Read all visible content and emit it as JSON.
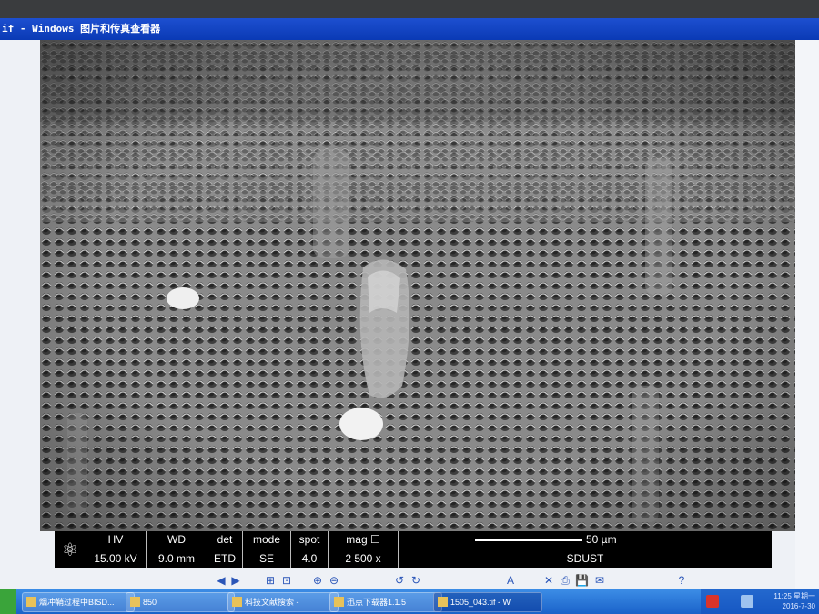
{
  "window": {
    "title": "if - Windows 图片和传真查看器"
  },
  "image": {
    "alt": "SEM micrograph"
  },
  "databar": {
    "columns": [
      {
        "header": "HV",
        "value": "15.00 kV"
      },
      {
        "header": "WD",
        "value": "9.0 mm"
      },
      {
        "header": "det",
        "value": "ETD"
      },
      {
        "header": "mode",
        "value": "SE"
      },
      {
        "header": "spot",
        "value": "4.0"
      },
      {
        "header": "mag ☐",
        "value": "2 500 x"
      }
    ],
    "scale_label": "50 µm",
    "institution": "SDUST"
  },
  "toolbar": {
    "buttons": [
      "◀",
      "▶",
      "⊞",
      "⊡",
      "⊕",
      "⊖",
      "↺",
      "↻",
      "✕",
      "⎙",
      "💾",
      "✉",
      "A",
      "?"
    ]
  },
  "taskbar": {
    "tasks": [
      {
        "label": "烟冲鞘过程中BISD..."
      },
      {
        "label": "850"
      },
      {
        "label": "科技文献搜索 -"
      },
      {
        "label": "迅点下载器1.1.5"
      },
      {
        "label": "1505_043.tif - W"
      }
    ],
    "clock_time": "11:25 星期一",
    "clock_date": "2016-7-30"
  },
  "colors": {
    "titlebar": "#0a3ab5",
    "taskbar": "#1a62c9",
    "databar": "#000000"
  }
}
